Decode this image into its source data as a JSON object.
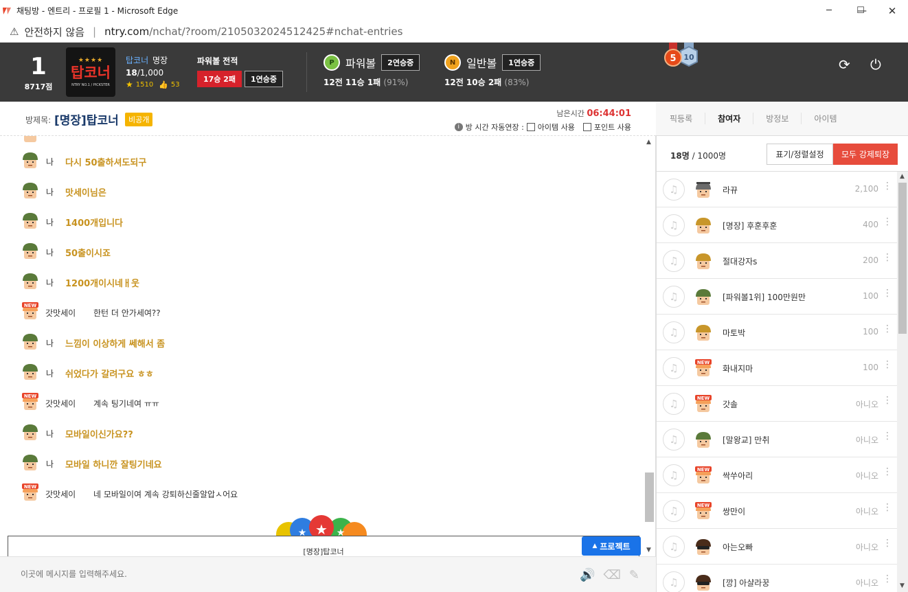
{
  "window": {
    "title": "채팅방 - 엔트리 - 프로필 1 - Microsoft Edge"
  },
  "address": {
    "security": "안전하지 않음",
    "host": "ntry.com",
    "path": "/nchat/?room/2105032024512425#nchat-entries"
  },
  "profile": {
    "level": "1",
    "points": "8717점",
    "logo_text": "탑코너",
    "logo_stars": "★★★★",
    "logo_sub": "NTRY NO.1 / PICKSTER",
    "name": "탑코너",
    "rank": "명장",
    "members_current": "18",
    "members_total": "/1,000",
    "star_count": "1510",
    "like_count": "53"
  },
  "record": {
    "title": "파워볼 전적",
    "winloss": "17승 2패",
    "streak": "1연승중"
  },
  "games": [
    {
      "icon": "P",
      "name": "파워볼",
      "streak": "2연승중",
      "summary": "12전 11승 1패",
      "pct": "(91%)"
    },
    {
      "icon": "N",
      "name": "일반볼",
      "streak": "1연승중",
      "summary": "12전 10승 2패",
      "pct": "(83%)"
    }
  ],
  "medals": [
    "5",
    "10"
  ],
  "room": {
    "label": "방제목:",
    "title": "[명장]탑코너",
    "private_badge": "비공개",
    "remaining_label": "남은시간",
    "remaining_time": "06:44:01",
    "auto_extend": "방 시간 자동연장 :",
    "opt_item": "아이템 사용",
    "opt_point": "포인트 사용"
  },
  "tabs": [
    "픽등록",
    "참여자",
    "방정보",
    "아이템"
  ],
  "messages": [
    {
      "type": "me",
      "nick": "나",
      "text": "다시 50출하셔도되구"
    },
    {
      "type": "me",
      "nick": "나",
      "text": "맛세이님은"
    },
    {
      "type": "me",
      "nick": "나",
      "text": "1400개입니다"
    },
    {
      "type": "me",
      "nick": "나",
      "text": "50출이시죠"
    },
    {
      "type": "me",
      "nick": "나",
      "text": "1200개이시네ㅐ웃"
    },
    {
      "type": "other",
      "nick": "갓맛세이",
      "text": "한턴 더 안가세여??"
    },
    {
      "type": "me",
      "nick": "나",
      "text": "느낌이 이상하게 쎄해서 좀"
    },
    {
      "type": "me",
      "nick": "나",
      "text": "쉬었다가 갈려구요 ㅎㅎ"
    },
    {
      "type": "other",
      "nick": "갓맛세이",
      "text": "계속 팅기네여 ㅠㅠ"
    },
    {
      "type": "me",
      "nick": "나",
      "text": "모바일이신가요??"
    },
    {
      "type": "me",
      "nick": "나",
      "text": "모바일 하니깐 잘팅기네요"
    },
    {
      "type": "other",
      "nick": "갓맛세이",
      "text": "네 모바일이여 계속 강퇴하신줄알압ㅅ어요"
    }
  ],
  "project": {
    "room_name": "[명장]탑코너",
    "button": "프로젝트"
  },
  "input": {
    "placeholder": "이곳에 메시지를 입력해주세요."
  },
  "participants": {
    "count": "18명",
    "max": "/ 1000명",
    "sort_button": "표기/정렬설정",
    "kick_button": "모두 강제퇴장",
    "list": [
      {
        "name": "라뀨",
        "value": "2,100",
        "avatar": "gray"
      },
      {
        "name": "[명장] 후훈후훈",
        "value": "400",
        "avatar": "orange"
      },
      {
        "name": "절대강자s",
        "value": "200",
        "avatar": "orange"
      },
      {
        "name": "[파워볼1위] 100만원만",
        "value": "100",
        "avatar": "green"
      },
      {
        "name": "마토박",
        "value": "100",
        "avatar": "orange"
      },
      {
        "name": "화내지마",
        "value": "100",
        "avatar": "new"
      },
      {
        "name": "갓솔",
        "value": "아니오",
        "avatar": "new"
      },
      {
        "name": "[말왕교] 만취",
        "value": "아니오",
        "avatar": "green"
      },
      {
        "name": "싹쑤아리",
        "value": "아니오",
        "avatar": "new"
      },
      {
        "name": "쌍만이",
        "value": "아니오",
        "avatar": "new"
      },
      {
        "name": "아는오빠",
        "value": "아니오",
        "avatar": "goggle"
      },
      {
        "name": "[깡] 아샬라꿍",
        "value": "아니오",
        "avatar": "goggle"
      }
    ]
  },
  "colors": {
    "header_bg": "#3a3a3a",
    "accent_red": "#d6222b",
    "my_text": "#c89320",
    "kick_red": "#e74c3c",
    "project_blue": "#1a73e8"
  }
}
